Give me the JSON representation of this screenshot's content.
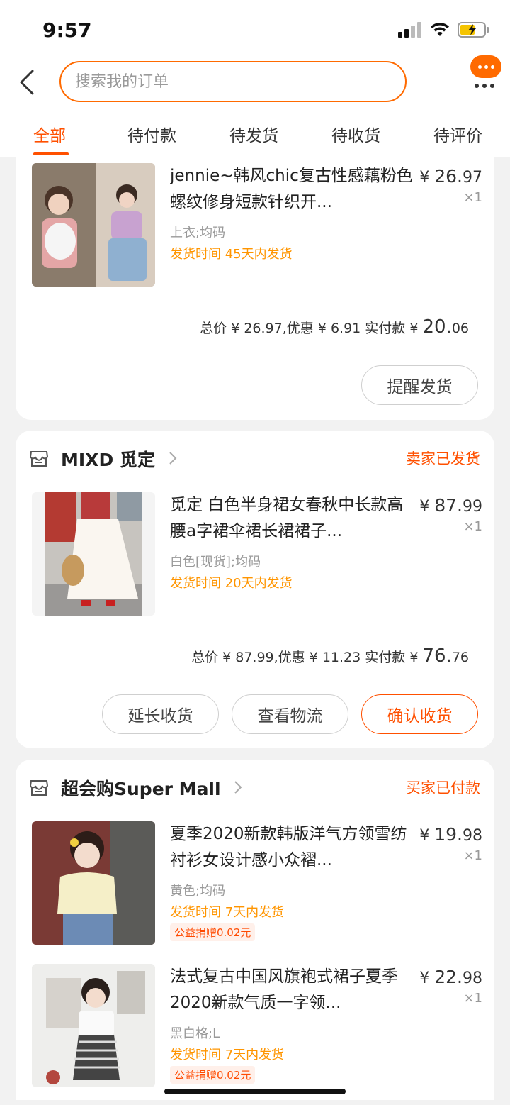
{
  "status_bar": {
    "time": "9:57"
  },
  "search": {
    "placeholder": "搜索我的订单"
  },
  "tabs": [
    "全部",
    "待付款",
    "待发货",
    "待收货",
    "待评价"
  ],
  "orders": [
    {
      "items": [
        {
          "title": "jennie~韩风chic复古性感藕粉色螺纹修身短款针织开...",
          "price_symbol": "¥",
          "price_int": "26.",
          "price_dec": "97",
          "qty": "×1",
          "spec": "上衣;均码",
          "ship": "发货时间  45天内发货"
        }
      ],
      "summary": {
        "prefix": "总价 ¥ 26.97,优惠 ¥ 6.91  实付款 ¥ ",
        "int": "20.",
        "dec": "06"
      },
      "buttons": [
        "提醒发货"
      ]
    },
    {
      "shop": "MIXD 觅定",
      "status": "卖家已发货",
      "items": [
        {
          "title": "觅定 白色半身裙女春秋中长款高腰a字裙伞裙长裙裙子...",
          "price_symbol": "¥",
          "price_int": "87.",
          "price_dec": "99",
          "qty": "×1",
          "spec": "白色[现货];均码",
          "ship": "发货时间  20天内发货"
        }
      ],
      "summary": {
        "prefix": "总价 ¥ 87.99,优惠 ¥ 11.23  实付款 ¥ ",
        "int": "76.",
        "dec": "76"
      },
      "buttons": [
        "延长收货",
        "查看物流",
        "确认收货"
      ]
    },
    {
      "shop": "超会购Super Mall",
      "status": "买家已付款",
      "items": [
        {
          "title": "夏季2020新款韩版洋气方领雪纺衬衫女设计感小众褶...",
          "price_symbol": "¥",
          "price_int": "19.",
          "price_dec": "98",
          "qty": "×1",
          "spec": "黄色;均码",
          "ship": "发货时间  7天内发货",
          "tag": "公益捐赠0.02元"
        },
        {
          "title": "法式复古中国风旗袍式裙子夏季2020新款气质一字领...",
          "price_symbol": "¥",
          "price_int": "22.",
          "price_dec": "98",
          "qty": "×1",
          "spec": "黑白格;L",
          "ship": "发货时间  7天内发货",
          "tag": "公益捐赠0.02元"
        }
      ]
    }
  ],
  "colors": {
    "accent": "#ff5000",
    "ship_text": "#ff9500",
    "background": "#f2f2f2"
  },
  "icons": [
    "back-arrow-icon",
    "message-bubble-icon",
    "more-dots-icon",
    "store-icon",
    "chevron-right-icon",
    "signal-icon",
    "wifi-icon",
    "battery-charging-icon"
  ]
}
